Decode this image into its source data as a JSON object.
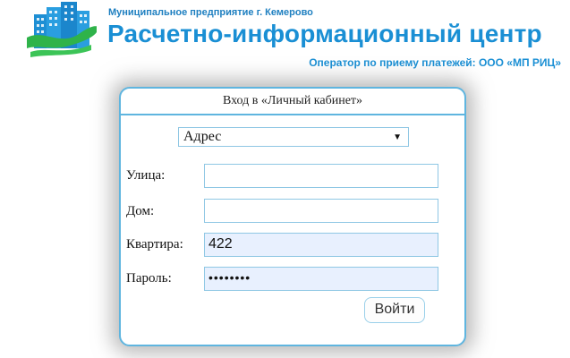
{
  "header": {
    "org_subtitle": "Муниципальное предприятие г. Кемерово",
    "org_title": "Расчетно-информационный центр",
    "operator": "Оператор по приему платежей: ООО «МП РИЦ»"
  },
  "login": {
    "title": "Вход в «Личный кабинет»",
    "search_type": {
      "selected": "Адрес"
    },
    "street": {
      "label": "Улица:",
      "value": ""
    },
    "house": {
      "label": "Дом:",
      "value": ""
    },
    "apartment": {
      "label": "Квартира:",
      "value": "422"
    },
    "password": {
      "label": "Пароль:",
      "value_masked": "••••••••"
    },
    "submit_label": "Войти"
  },
  "colors": {
    "brand_blue": "#1a8fd4",
    "logo_green": "#2fb34a",
    "panel_border": "#5fb5df",
    "autofill_bg": "#e8f0fe"
  }
}
